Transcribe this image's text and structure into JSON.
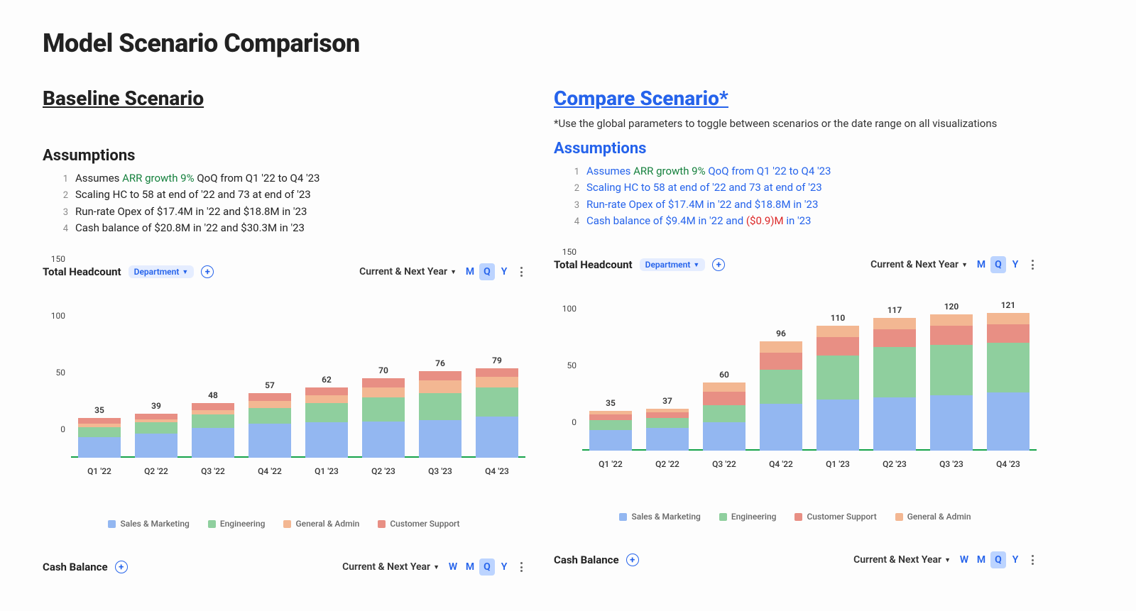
{
  "page_title": "Model Scenario Comparison",
  "baseline": {
    "heading": "Baseline Scenario",
    "assumptions_heading": "Assumptions",
    "assumptions": [
      {
        "pre": "Assumes ",
        "green": "ARR growth 9%",
        "post": " QoQ  from Q1 '22 to Q4 '23"
      },
      {
        "text": "Scaling HC to 58 at end of '22 and 73 at end of '23"
      },
      {
        "text": "Run-rate Opex of $17.4M in '22 and $18.8M in '23"
      },
      {
        "text": "Cash balance of $20.8M in '22 and $30.3M in '23"
      }
    ]
  },
  "compare": {
    "heading": "Compare Scenario*",
    "note": "*Use the global parameters to toggle between scenarios or the date range on all visualizations",
    "assumptions_heading": "Assumptions",
    "assumptions": [
      {
        "pre": "Assumes ",
        "green": "ARR growth 9%",
        "post": " QoQ  from Q1 '22 to Q4 '23"
      },
      {
        "text": "Scaling HC to 58 at end of '22 and 73 at end of '23"
      },
      {
        "text": "Run-rate Opex of $17.4M in '22 and $18.8M in '23"
      },
      {
        "pre2": "Cash balance of $9.4M in '22 and ",
        "red": "($0.9)M",
        "post2": " in '23"
      }
    ]
  },
  "chart_header": {
    "title": "Total Headcount",
    "pill": "Department",
    "range_label": "Current & Next Year",
    "periods": {
      "w": "W",
      "m": "M",
      "q": "Q",
      "y": "Y"
    }
  },
  "cash_header": {
    "title": "Cash Balance",
    "range_label": "Current & Next Year"
  },
  "chart_data": [
    {
      "type": "bar",
      "title": "Total Headcount (Baseline)",
      "ylabel": "Headcount",
      "ylim": [
        0,
        150
      ],
      "categories": [
        "Q1 '22",
        "Q2 '22",
        "Q3 '22",
        "Q4 '22",
        "Q1 '23",
        "Q2 '23",
        "Q3 '23",
        "Q4 '23"
      ],
      "totals": [
        35,
        39,
        48,
        57,
        62,
        70,
        76,
        79
      ],
      "legend": [
        "Sales & Marketing",
        "Engineering",
        "General & Admin",
        "Customer Support"
      ],
      "series": [
        {
          "name": "Sales & Marketing",
          "values": [
            18,
            21,
            26,
            30,
            31,
            32,
            33,
            36
          ]
        },
        {
          "name": "Engineering",
          "values": [
            9,
            10,
            12,
            14,
            17,
            21,
            24,
            26
          ]
        },
        {
          "name": "General & Admin",
          "values": [
            3,
            3,
            4,
            6,
            7,
            9,
            11,
            9
          ]
        },
        {
          "name": "Customer Support",
          "values": [
            5,
            5,
            6,
            7,
            7,
            8,
            8,
            8
          ]
        }
      ]
    },
    {
      "type": "bar",
      "title": "Total Headcount (Compare)",
      "ylabel": "Headcount",
      "ylim": [
        0,
        150
      ],
      "categories": [
        "Q1 '22",
        "Q2 '22",
        "Q3 '22",
        "Q4 '22",
        "Q1 '23",
        "Q2 '23",
        "Q3 '23",
        "Q4 '23"
      ],
      "totals": [
        35,
        37,
        60,
        96,
        110,
        117,
        120,
        121
      ],
      "legend": [
        "Sales & Marketing",
        "Engineering",
        "Customer Support",
        "General & Admin"
      ],
      "series": [
        {
          "name": "Sales & Marketing",
          "values": [
            18,
            20,
            25,
            41,
            45,
            47,
            49,
            51
          ]
        },
        {
          "name": "Engineering",
          "values": [
            9,
            9,
            15,
            30,
            39,
            44,
            44,
            44
          ]
        },
        {
          "name": "Customer Support",
          "values": [
            5,
            5,
            12,
            15,
            16,
            16,
            17,
            16
          ]
        },
        {
          "name": "General & Admin",
          "values": [
            3,
            3,
            8,
            10,
            10,
            10,
            10,
            10
          ]
        }
      ]
    }
  ]
}
